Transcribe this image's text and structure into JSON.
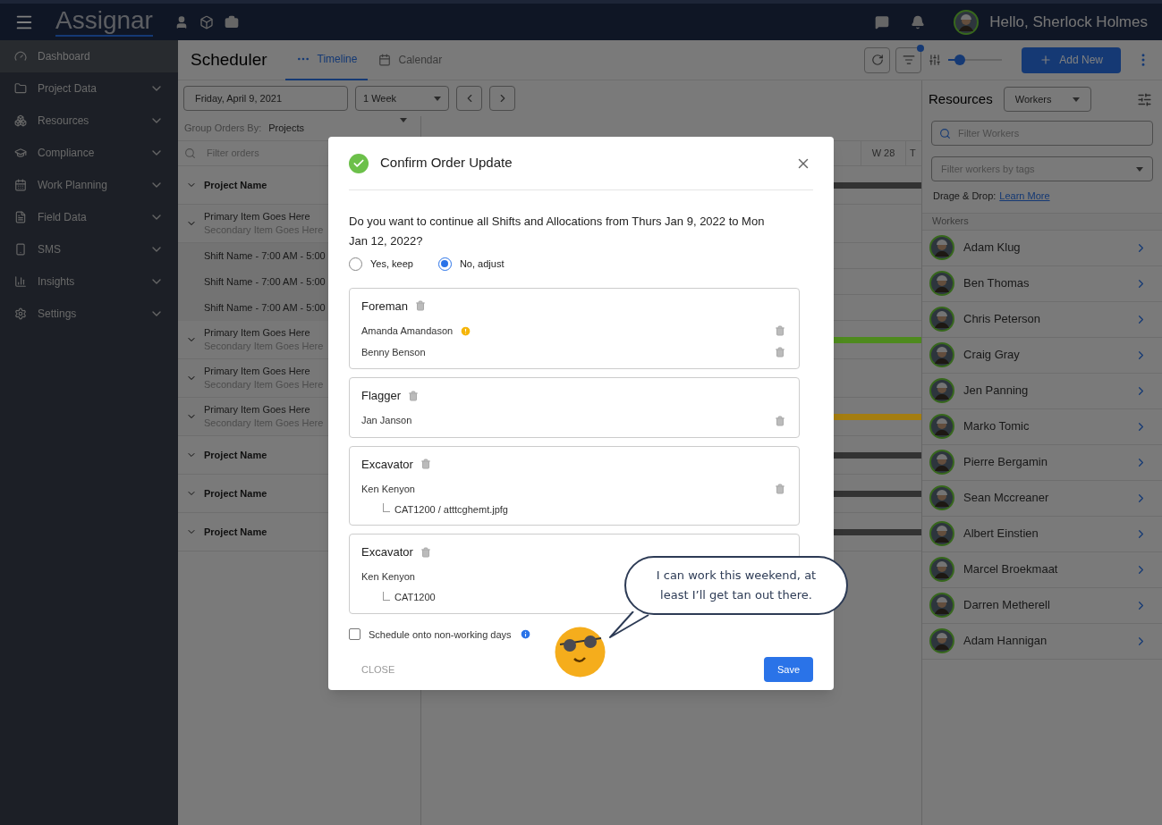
{
  "topbar": {
    "logo": "Assignar",
    "greeting": "Hello, Sherlock Holmes"
  },
  "sidebar": {
    "items": [
      {
        "label": "Dashboard",
        "selected": true,
        "expandable": false
      },
      {
        "label": "Project Data",
        "selected": false,
        "expandable": true
      },
      {
        "label": "Resources",
        "selected": false,
        "expandable": true
      },
      {
        "label": "Compliance",
        "selected": false,
        "expandable": true
      },
      {
        "label": "Work Planning",
        "selected": false,
        "expandable": true
      },
      {
        "label": "Field Data",
        "selected": false,
        "expandable": true
      },
      {
        "label": "SMS",
        "selected": false,
        "expandable": true
      },
      {
        "label": "Insights",
        "selected": false,
        "expandable": true
      },
      {
        "label": "Settings",
        "selected": false,
        "expandable": true
      }
    ]
  },
  "scheduler": {
    "title": "Scheduler",
    "tabs": [
      {
        "label": "Timeline",
        "selected": true
      },
      {
        "label": "Calendar",
        "selected": false
      }
    ],
    "filter_badge": true,
    "zoom": {
      "level": 0.15
    },
    "add_button": "Add New",
    "date": "Friday, April 9, 2021",
    "range": "1 Week",
    "group_by": {
      "label": "Group Orders By:",
      "value": "Projects"
    },
    "filter_placeholder": "Filter orders",
    "week_columns": [
      "W 28",
      "T"
    ],
    "orders": [
      {
        "kind": "project",
        "label": "Project Name",
        "color": "#333333"
      },
      {
        "kind": "item",
        "label": "Primary Item Goes Here",
        "secondary": "Secondary Item Goes Here"
      },
      {
        "kind": "shift",
        "label": "Shift Name - 7:00 AM - 5:00"
      },
      {
        "kind": "shift",
        "label": "Shift Name - 7:00 AM - 5:00"
      },
      {
        "kind": "shift",
        "label": "Shift Name - 7:00 AM - 5:00"
      },
      {
        "kind": "item",
        "label": "Primary Item Goes Here",
        "secondary": "Secondary Item Goes Here",
        "color": "#4e8a1e"
      },
      {
        "kind": "item",
        "label": "Primary Item Goes Here",
        "secondary": "Secondary Item Goes Here"
      },
      {
        "kind": "item",
        "label": "Primary Item Goes Here",
        "secondary": "Secondary Item Goes Here",
        "color": "#a47d10"
      },
      {
        "kind": "project",
        "label": "Project Name",
        "color": "#333333"
      },
      {
        "kind": "project",
        "label": "Project Name",
        "color": "#333333"
      },
      {
        "kind": "project",
        "label": "Project Name",
        "color": "#333333"
      }
    ]
  },
  "resources": {
    "title": "Resources",
    "type": "Workers",
    "filter_placeholder": "Filter Workers",
    "tags_placeholder": "Filter workers by tags",
    "drag_label": "Drage & Drop:",
    "drag_link": "Learn More",
    "section": "Workers",
    "workers": [
      "Adam Klug",
      "Ben Thomas",
      "Chris Peterson",
      "Craig Gray",
      "Jen Panning",
      "Marko Tomic",
      "Pierre Bergamin",
      "Sean Mccreaner",
      "Albert Einstien",
      "Marcel Broekmaat",
      "Darren Metherell",
      "Adam Hannigan"
    ]
  },
  "dialog": {
    "title": "Confirm Order Update",
    "question": "Do you want to continue all Shifts and Allocations from Thurs Jan 9, 2022 to Mon Jan 12, 2022?",
    "options": [
      {
        "label": "Yes, keep",
        "selected": false
      },
      {
        "label": "No, adjust",
        "selected": true
      }
    ],
    "groups": [
      {
        "title": "Foreman",
        "members": [
          {
            "name": "Amanda Amandason",
            "warning": true,
            "deletable": true
          },
          {
            "name": "Benny Benson",
            "warning": false,
            "deletable": true
          }
        ]
      },
      {
        "title": "Flagger",
        "members": [
          {
            "name": "Jan Janson",
            "warning": false,
            "deletable": true
          }
        ]
      },
      {
        "title": "Excavator",
        "members": [
          {
            "name": "Ken Kenyon",
            "warning": false,
            "deletable": true,
            "equipment": "CAT1200 / atttcghemt.jpfg"
          }
        ]
      },
      {
        "title": "Excavator",
        "members": [
          {
            "name": "Ken Kenyon",
            "warning": false,
            "equipment": "CAT1200"
          }
        ]
      }
    ],
    "checkbox": {
      "label": "Schedule onto non-working days",
      "checked": false
    },
    "close": "CLOSE",
    "save": "Save",
    "bubble": "I can work this weekend, at least I’ll get tan out there."
  }
}
